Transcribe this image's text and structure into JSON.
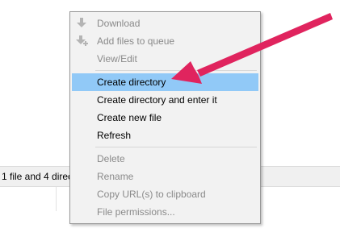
{
  "status_bar": {
    "text": "1 file and 4 direc"
  },
  "context_menu": {
    "items": [
      {
        "label": "Download",
        "icon": "download-icon",
        "enabled": false
      },
      {
        "label": "Add files to queue",
        "icon": "add-to-queue-icon",
        "enabled": false
      },
      {
        "label": "View/Edit",
        "enabled": false
      },
      {
        "label": "Create directory",
        "enabled": true,
        "highlighted": true
      },
      {
        "label": "Create directory and enter it",
        "enabled": true
      },
      {
        "label": "Create new file",
        "enabled": true
      },
      {
        "label": "Refresh",
        "enabled": true
      },
      {
        "label": "Delete",
        "enabled": false
      },
      {
        "label": "Rename",
        "enabled": false
      },
      {
        "label": "Copy URL(s) to clipboard",
        "enabled": false
      },
      {
        "label": "File permissions...",
        "enabled": false
      }
    ]
  },
  "colors": {
    "highlight": "#91c9f7",
    "menu_background": "#f2f2f2",
    "disabled_text": "#8a8a8a",
    "annotation_arrow": "#e0245e"
  }
}
